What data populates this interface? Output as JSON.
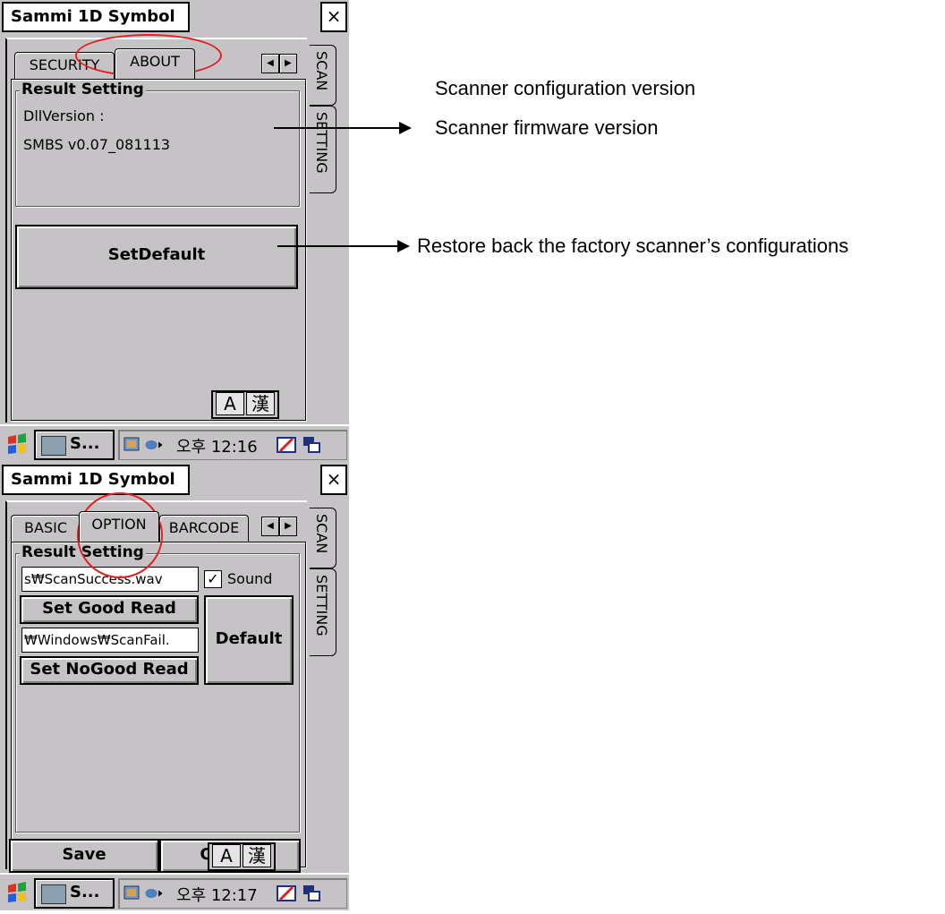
{
  "screen_top": {
    "window_title": "Sammi 1D Symbol",
    "close_label": "×",
    "tabs": [
      "SECURITY",
      "ABOUT"
    ],
    "side_tabs": [
      "SCAN",
      "SETTING"
    ],
    "group_title": "Result Setting",
    "dll_label": "DllVersion :",
    "dll_value": "SMBS v0.07_081113",
    "set_default_label": "SetDefault",
    "ime": [
      "A",
      "漢"
    ],
    "taskbar": {
      "task_label": "S...",
      "clock": "오후 12:16"
    }
  },
  "screen_bottom": {
    "window_title": "Sammi 1D Symbol",
    "close_label": "×",
    "tabs": [
      "BASIC",
      "OPTION",
      "BARCODE"
    ],
    "side_tabs": [
      "SCAN",
      "SETTING"
    ],
    "group_title": "Result Setting",
    "good_read_file": "s₩ScanSuccess.wav",
    "sound_label": "Sound",
    "sound_checked": true,
    "set_good_read_label": "Set Good Read",
    "nogood_read_file": "₩Windows₩ScanFail.",
    "default_label": "Default",
    "set_nogood_read_label": "Set NoGood Read",
    "save_label": "Save",
    "cancel_label": "Cancel",
    "ime": [
      "A",
      "漢"
    ],
    "taskbar": {
      "task_label": "S...",
      "clock": "오후 12:17"
    }
  },
  "annotations": {
    "config_version": "Scanner configuration version",
    "firmware_version": "Scanner firmware version",
    "restore": "Restore back the factory scanner’s configurations"
  },
  "colors": {
    "dialog_bg": "#c6c3c6",
    "highlight_ellipse": "#e02020"
  }
}
